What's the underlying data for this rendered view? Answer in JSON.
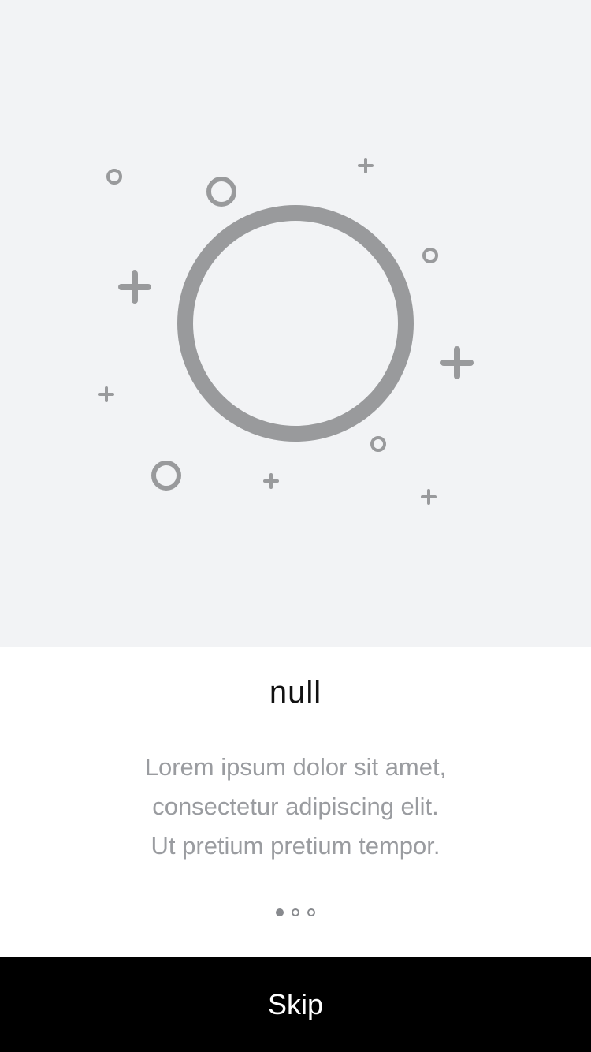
{
  "onboarding": {
    "illustration": {
      "icon": "circle-icon",
      "decorations": [
        "small-circle-icon",
        "plus-icon"
      ],
      "color": "#999a9c"
    },
    "title": "null",
    "description_lines": [
      "Lorem ipsum dolor sit amet,",
      "consectetur adipiscing elit.",
      "Ut pretium pretium tempor."
    ],
    "pagination": {
      "current": 1,
      "total": 3
    },
    "skip_label": "Skip"
  },
  "colors": {
    "hero_background": "#f2f3f5",
    "skip_background": "#000000",
    "skip_text": "#ffffff",
    "description_text": "#9a9ca0"
  }
}
